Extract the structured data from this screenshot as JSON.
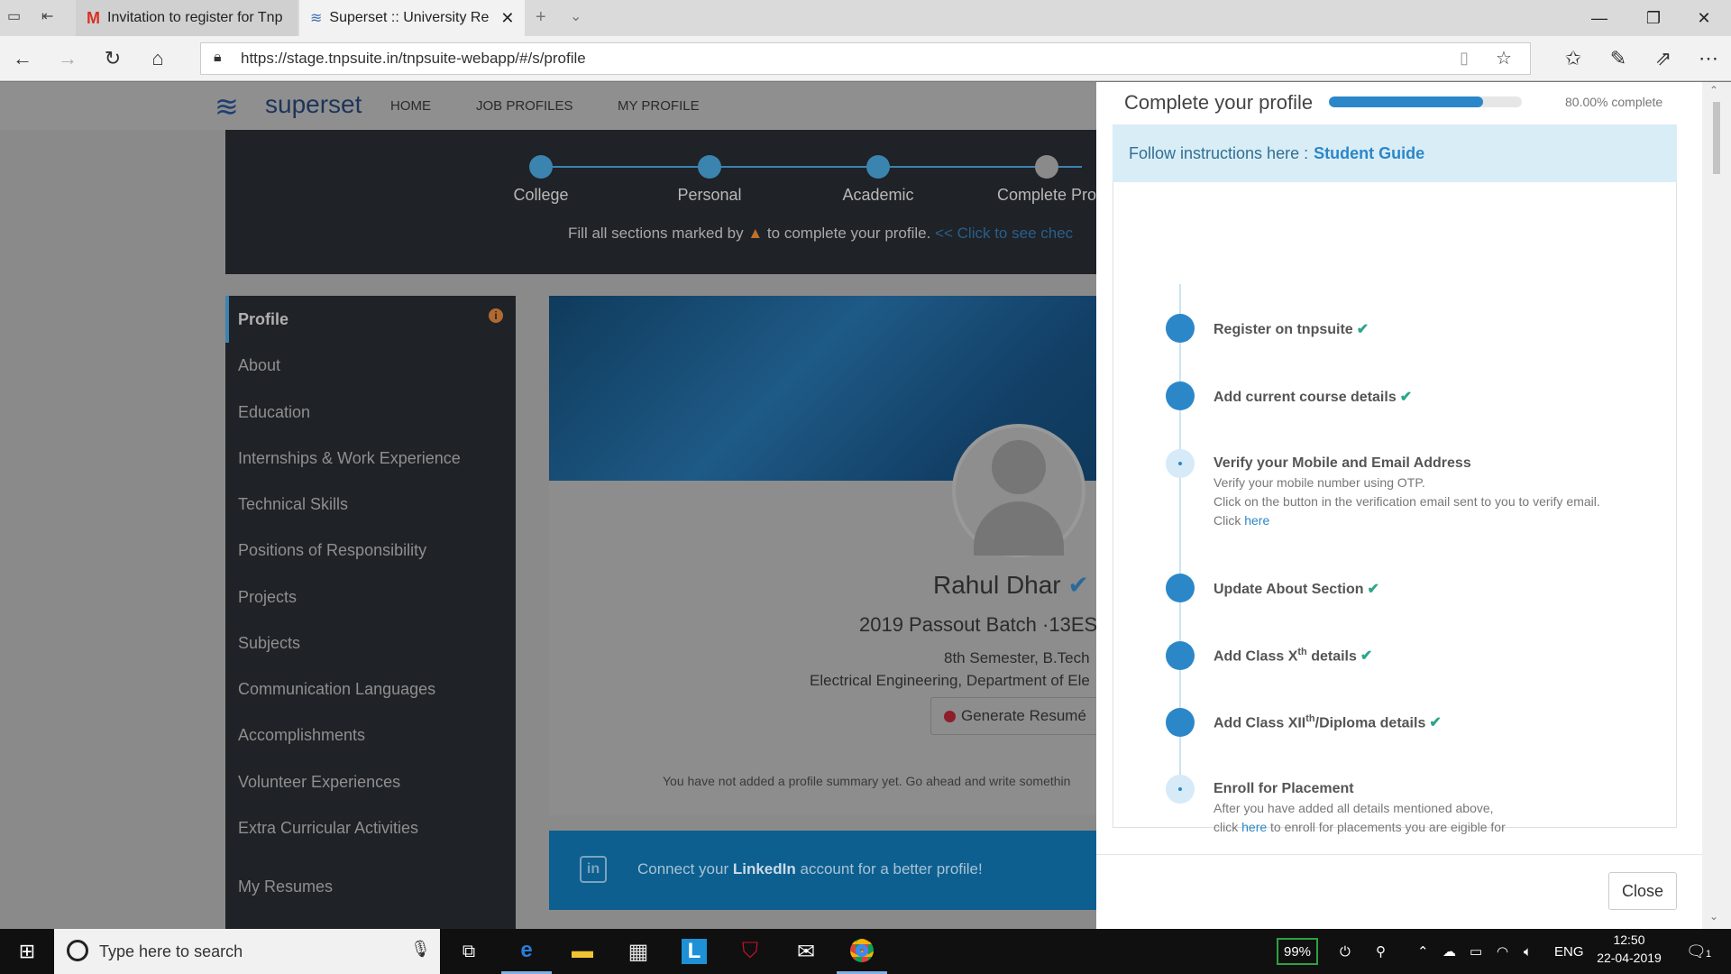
{
  "browser": {
    "tabs": [
      {
        "label": "Invitation to register for Tnp",
        "icon": "gmail-icon"
      },
      {
        "label": "Superset :: University Re",
        "icon": "superset-icon"
      }
    ],
    "url": "https://stage.tnpsuite.in/tnpsuite-webapp/#/s/profile"
  },
  "site": {
    "brand": "superset",
    "nav": [
      "HOME",
      "JOB PROFILES",
      "MY PROFILE"
    ],
    "steps": [
      "College",
      "Personal",
      "Academic",
      "Complete Profi"
    ],
    "hint_prefix": "Fill all sections marked by",
    "hint_suffix": "to complete your profile.",
    "hint_link": "<< Click to see chec",
    "sidebar": [
      "Profile",
      "About",
      "Education",
      "Internships & Work Experience",
      "Technical Skills",
      "Positions of Responsibility",
      "Projects",
      "Subjects",
      "Communication Languages",
      "Accomplishments",
      "Volunteer Experiences",
      "Extra Curricular Activities",
      "My Resumes"
    ],
    "profile": {
      "name": "Rahul Dhar",
      "batch": "2019 Passout Batch ·13ES",
      "semester": "8th Semester, B.Tech",
      "department": "Electrical Engineering, Department of Ele",
      "resume_button": "Generate Resumé",
      "summary_hint": "You have not added a profile summary yet. Go ahead and write somethin"
    },
    "linkedin": {
      "prefix": "Connect your",
      "bold": "LinkedIn",
      "suffix": "account for a better profile!"
    }
  },
  "panel": {
    "title": "Complete your profile",
    "progress_fraction": 0.8,
    "progress_text": "80.00% complete",
    "info_prefix": "Follow instructions here :",
    "info_link": "Student Guide",
    "steps": [
      {
        "title": "Register on tnpsuite",
        "done": true
      },
      {
        "title": "Add current course details",
        "done": true
      },
      {
        "title": "Verify your Mobile and Email Address",
        "done": false,
        "sub1": "Verify your mobile number using OTP.",
        "sub2": "Click on the button in the verification email sent to you to verify email.",
        "sub3": "Click",
        "sub3_link": "here"
      },
      {
        "title": "Update About Section",
        "done": true
      },
      {
        "title_a": "Add Class X",
        "sup": "th",
        "title_b": " details",
        "done": true
      },
      {
        "title_a": "Add Class XII",
        "sup": "th",
        "title_b": "/Diploma details",
        "done": true
      },
      {
        "title": "Enroll for Placement",
        "done": false,
        "sub1": "After you have added all details mentioned above,",
        "sub2_a": "click",
        "sub2_link": "here",
        "sub2_b": "to enroll for placements you are eigible for"
      }
    ],
    "close_label": "Close"
  },
  "taskbar": {
    "search_placeholder": "Type here to search",
    "battery": "99%",
    "language": "ENG",
    "time": "12:50",
    "date": "22-04-2019",
    "notifications": "1"
  }
}
